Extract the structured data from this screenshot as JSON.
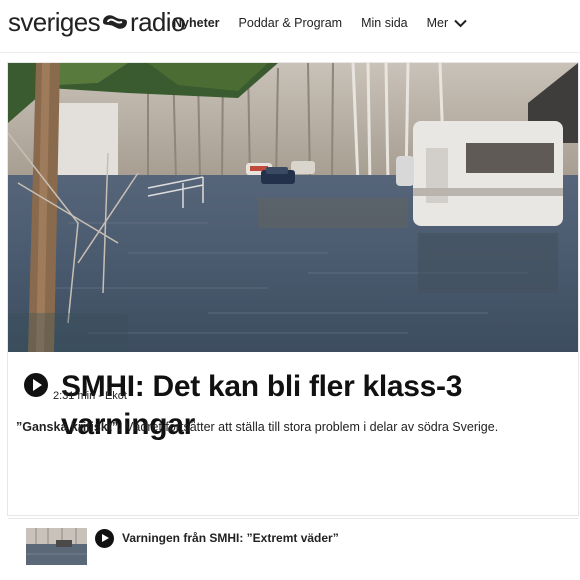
{
  "header": {
    "logo_left": "sveriges",
    "logo_right": "radio",
    "nav": [
      {
        "label": "Nyheter",
        "active": true
      },
      {
        "label": "Poddar & Program",
        "active": false
      },
      {
        "label": "Min sida",
        "active": false
      }
    ],
    "more_label": "Mer"
  },
  "article": {
    "headline": "SMHI: Det kan bli fler klass-3 varningar",
    "meta": "2:31 min - Ekot",
    "lede_quote": "”Ganska kritiskt”.",
    "lede_text": " Vädret fortsätter att ställa till stora problem i delar av södra Sverige."
  },
  "related": {
    "title": "Varningen från SMHI: ”Extremt väder”"
  },
  "colors": {
    "text": "#111111",
    "divider": "#e7e7e7",
    "water": "#4a5a6e"
  }
}
